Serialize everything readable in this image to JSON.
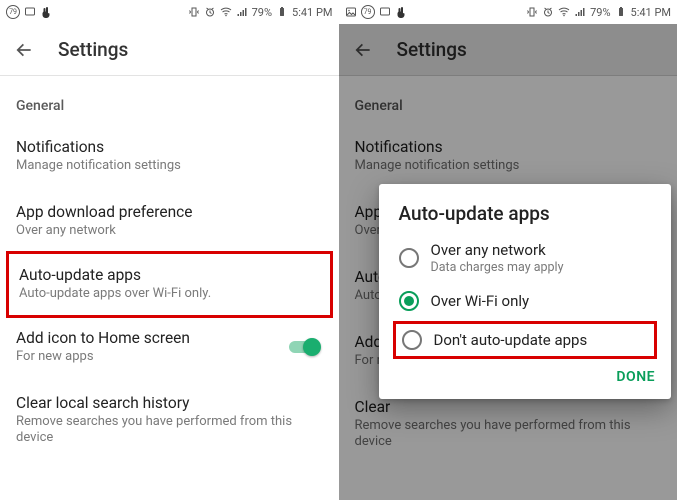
{
  "status": {
    "left_badge": "79",
    "battery": "79%",
    "time": "5:41 PM"
  },
  "appbar": {
    "title": "Settings"
  },
  "section": {
    "general": "General"
  },
  "items": {
    "notifications": {
      "title": "Notifications",
      "sub": "Manage notification settings"
    },
    "download": {
      "title": "App download preference",
      "sub": "Over any network"
    },
    "autoupdate": {
      "title": "Auto-update apps",
      "sub": "Auto-update apps over Wi-Fi only."
    },
    "addicon": {
      "title": "Add icon to Home screen",
      "sub": "For new apps"
    },
    "clear": {
      "title": "Clear local search history",
      "sub": "Remove searches you have performed from this device"
    }
  },
  "right_items": {
    "auto_title": "Auto-up",
    "auto_sub": "Auto-",
    "addicon_title": "Add i",
    "addicon_sub": "For ne",
    "clear_title": "Clear",
    "download_title": "App c",
    "download_sub": "Over"
  },
  "dialog": {
    "title": "Auto-update apps",
    "opt1": {
      "label": "Over any network",
      "sub": "Data charges may apply"
    },
    "opt2": {
      "label": "Over Wi-Fi only"
    },
    "opt3": {
      "label": "Don't auto-update apps"
    },
    "done": "DONE"
  }
}
